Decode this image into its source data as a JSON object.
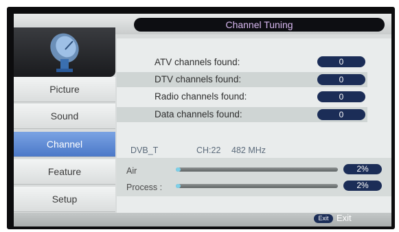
{
  "header": {
    "title": "Channel Tuning"
  },
  "sidebar": {
    "icon": "satellite-dish-icon",
    "items": [
      {
        "label": "Picture",
        "active": false
      },
      {
        "label": "Sound",
        "active": false
      },
      {
        "label": "Channel",
        "active": true
      },
      {
        "label": "Feature",
        "active": false
      },
      {
        "label": "Setup",
        "active": false
      }
    ]
  },
  "results": [
    {
      "label": "ATV channels found:",
      "value": "0"
    },
    {
      "label": "DTV channels found:",
      "value": "0"
    },
    {
      "label": "Radio channels found:",
      "value": "0"
    },
    {
      "label": "Data channels found:",
      "value": "0"
    }
  ],
  "scan": {
    "standard": "DVB_T",
    "channel": "CH:22",
    "frequency": "482 MHz"
  },
  "progress": [
    {
      "label": "Air",
      "percent_text": "2%",
      "fraction": 0.02
    },
    {
      "label": "Process :",
      "percent_text": "2%",
      "fraction": 0.02
    }
  ],
  "footer": {
    "key": "Exit",
    "label": "Exit"
  },
  "colors": {
    "accent_active": "#5a86d4",
    "pill_bg": "#1b2d57",
    "title_text": "#d8b8f0",
    "progress_fill": "#7fd0e8"
  }
}
